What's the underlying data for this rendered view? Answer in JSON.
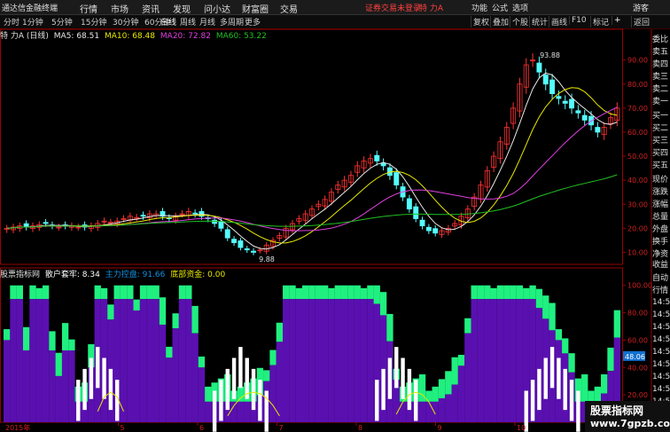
{
  "menubar": {
    "app_title": "通达信金融终端",
    "menus": [
      "行情",
      "市场",
      "资讯",
      "发现",
      "问小达",
      "财富圈",
      "交易"
    ],
    "notice": "证券交易未登录",
    "stock_name": "特 力A",
    "right_items": [
      "功能",
      "公式",
      "选项"
    ],
    "guest": "游客"
  },
  "toolbar": {
    "periods": [
      "分时",
      "1分钟",
      "5分钟",
      "15分钟",
      "30分钟",
      "60分钟",
      "日线",
      "周线",
      "月线",
      "多周期",
      "更多"
    ],
    "active_period": "日线",
    "buttons": [
      "复权",
      "叠加",
      "个股",
      "统计",
      "画线",
      "F10",
      "标记",
      "返回"
    ]
  },
  "main_panel": {
    "stock_label": "特 力A (日线)",
    "indicators": [
      {
        "label": "MA5: 68.51",
        "color": "#e8e8e8"
      },
      {
        "label": "MA10: 68.48",
        "color": "#e8e800"
      },
      {
        "label": "MA20: 72.82",
        "color": "#e040e0"
      },
      {
        "label": "MA60: 53.22",
        "color": "#20c020"
      }
    ],
    "high_label": "93.88",
    "low_label": "9.88",
    "y_ticks": [
      "90.00",
      "80.00",
      "70.00",
      "60.00",
      "50.00",
      "40.00",
      "30.00",
      "20.00",
      "10.00"
    ],
    "y_range": [
      5,
      98
    ]
  },
  "lower_panel": {
    "title": "股票指标网",
    "indicators": [
      {
        "label": "散户套牢: 8.34",
        "color": "#ffffff"
      },
      {
        "label": "主力控盘: 91.66",
        "color": "#1090e0"
      },
      {
        "label": "底部资金: 0.00",
        "color": "#e8e800"
      }
    ],
    "y_ticks": [
      "100.00",
      "80.00",
      "60.00",
      "40.00",
      "20.00"
    ],
    "current_value": "48.06"
  },
  "x_axis": {
    "labels": [
      "2015年",
      "5",
      "6",
      "7",
      "8",
      "9",
      "10",
      "11"
    ]
  },
  "orderbook": {
    "header": "委比",
    "items": [
      "卖五",
      "卖四",
      "卖三",
      "卖二",
      "卖一",
      "买一",
      "买二",
      "买三",
      "买四",
      "买五",
      "现价",
      "涨跌",
      "涨幅",
      "总量",
      "外盘",
      "换手",
      "净资",
      "收益"
    ]
  },
  "right_lower": {
    "header": "自动",
    "items": [
      "行情",
      "14:5",
      "14:5",
      "14:5",
      "14:5",
      "14:5",
      "14:5",
      "14:5",
      "14:5",
      "14:5"
    ]
  },
  "watermark": {
    "line1": "股票指标网",
    "line2": "www.7gpzb.com"
  },
  "colors": {
    "up": "#ff3232",
    "down": "#54fcfc",
    "ma5": "#e8e8e8",
    "ma10": "#e8e800",
    "ma20": "#e040e0",
    "ma60": "#20c020",
    "purple": "#5a10b0",
    "green": "#20f080",
    "axis": "#9a0000"
  },
  "chart_data": {
    "type": "candlestick",
    "price_series": [
      {
        "name": "close",
        "values": [
          20,
          20.5,
          21,
          20.5,
          21,
          21.5,
          22,
          21,
          20.5,
          21,
          21,
          20.5,
          20.5,
          21,
          22,
          23,
          22.5,
          23,
          24,
          25,
          24.5,
          25,
          26,
          26,
          25,
          24,
          25,
          26,
          27,
          26,
          25,
          24,
          22,
          20,
          16,
          14,
          12,
          11,
          10,
          11,
          13,
          15,
          17,
          20,
          22,
          24,
          26,
          28,
          30,
          32,
          35,
          38,
          40,
          42,
          46,
          48,
          49,
          48,
          46,
          42,
          38,
          33,
          28,
          24,
          21,
          19,
          18,
          19,
          20,
          22,
          25,
          28,
          33,
          38,
          44,
          50,
          56,
          62,
          70,
          80,
          88,
          90,
          85,
          80,
          76,
          74,
          72,
          70,
          68,
          65,
          63,
          60,
          62,
          66,
          70
        ]
      }
    ],
    "lower_series": [
      {
        "name": "散户套牢 (last)",
        "values": [
          8.34
        ]
      },
      {
        "name": "主力控盘 (last)",
        "values": [
          91.66
        ]
      },
      {
        "name": "底部资金 (last)",
        "values": [
          0.0
        ]
      }
    ]
  }
}
